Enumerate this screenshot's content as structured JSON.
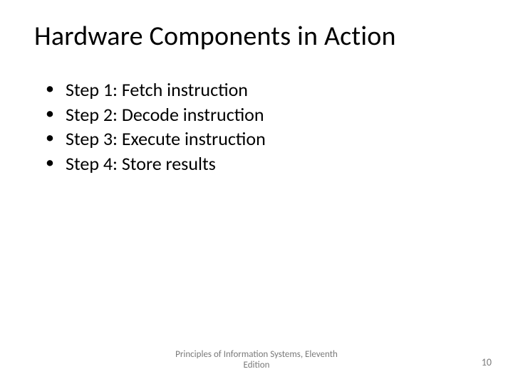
{
  "title": "Hardware Components in Action",
  "bullets": [
    "Step 1: Fetch instruction",
    "Step 2: Decode instruction",
    "Step 3: Execute instruction",
    "Step 4: Store results"
  ],
  "footer": "Principles of Information Systems, Eleventh Edition",
  "page_number": "10"
}
